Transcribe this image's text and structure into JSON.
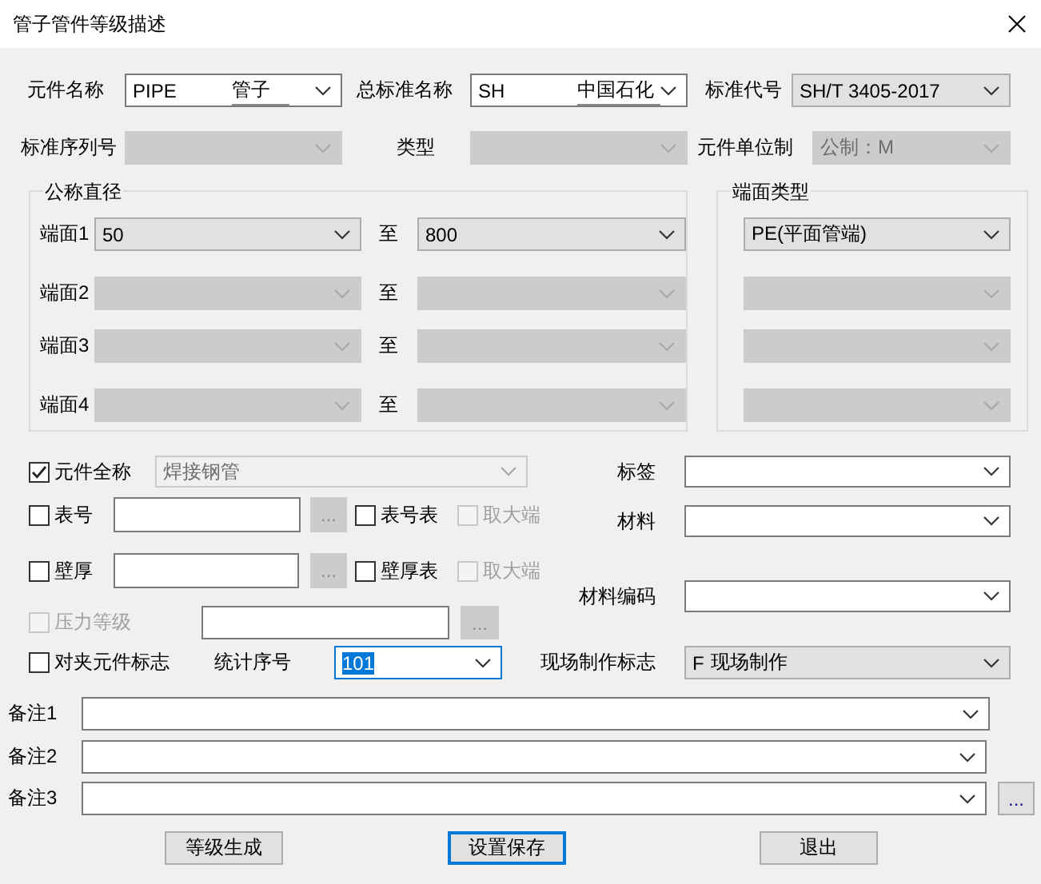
{
  "window": {
    "title": "管子管件等级描述"
  },
  "top_fields": [
    {
      "label": "元件名称",
      "kind": "edit",
      "code": "PIPE",
      "value": "管子",
      "disabled": false
    },
    {
      "label": "总标准名称",
      "kind": "edit",
      "code": "SH",
      "value": "中国石化",
      "disabled": false
    },
    {
      "label": "标准代号",
      "kind": "list",
      "value": "SH/T 3405-2017",
      "disabled": false
    },
    {
      "label": "标准序列号",
      "kind": "list",
      "disabled": true
    },
    {
      "label": "类型",
      "kind": "list",
      "disabled": true
    },
    {
      "label": "元件单位制",
      "kind": "list",
      "value": "公制：M",
      "disabled": true
    }
  ],
  "nominal_diameter": {
    "title": "公称直径",
    "rows": [
      {
        "label": "端面1",
        "from": "50",
        "separator": "至",
        "to": "800",
        "disabled": false
      },
      {
        "label": "端面2",
        "separator": "至",
        "disabled": true
      },
      {
        "label": "端面3",
        "separator": "至",
        "disabled": true
      },
      {
        "label": "端面4",
        "separator": "至",
        "disabled": true
      }
    ]
  },
  "end_type": {
    "title": "端面类型",
    "rows": [
      {
        "value": "PE(平面管端)",
        "disabled": false
      },
      {
        "disabled": true
      },
      {
        "disabled": true
      },
      {
        "disabled": true
      }
    ]
  },
  "full_name": {
    "checkbox": {
      "label": "元件全称",
      "checked": true,
      "disabled": false
    },
    "value": "焊接钢管",
    "value_disabled": true
  },
  "table_no": {
    "checkbox": {
      "label": "表号",
      "checked": false,
      "disabled": false
    },
    "browse": {
      "text": "...",
      "disabled": true
    },
    "table": {
      "label": "表号表",
      "checked": false,
      "disabled": false
    },
    "max_end": {
      "label": "取大端",
      "checked": false,
      "disabled": true
    }
  },
  "wall_thickness": {
    "checkbox": {
      "label": "壁厚",
      "checked": false,
      "disabled": false
    },
    "browse": {
      "text": "...",
      "disabled": true
    },
    "table": {
      "label": "壁厚表",
      "checked": false,
      "disabled": false
    },
    "max_end": {
      "label": "取大端",
      "checked": false,
      "disabled": true
    }
  },
  "pressure_class": {
    "checkbox": {
      "label": "压力等级",
      "checked": false,
      "disabled": true
    },
    "browse": {
      "text": "...",
      "disabled": true
    }
  },
  "wafer_flag": {
    "checkbox": {
      "label": "对夹元件标志",
      "checked": false,
      "disabled": false
    }
  },
  "serial_no": {
    "label": "统计序号",
    "value": "101",
    "focused": true
  },
  "right_fields": [
    {
      "label": "标签",
      "kind": "edit"
    },
    {
      "label": "材料",
      "kind": "edit"
    },
    {
      "label": "材料编码",
      "kind": "edit"
    },
    {
      "label": "现场制作标志",
      "kind": "list",
      "code": "F",
      "value": "现场制作"
    }
  ],
  "remarks": [
    {
      "label": "备注1"
    },
    {
      "label": "备注2"
    },
    {
      "label": "备注3",
      "browse": "..."
    }
  ],
  "buttons": [
    {
      "label": "等级生成",
      "default": false
    },
    {
      "label": "设置保存",
      "default": true
    },
    {
      "label": "退出",
      "default": false
    }
  ]
}
